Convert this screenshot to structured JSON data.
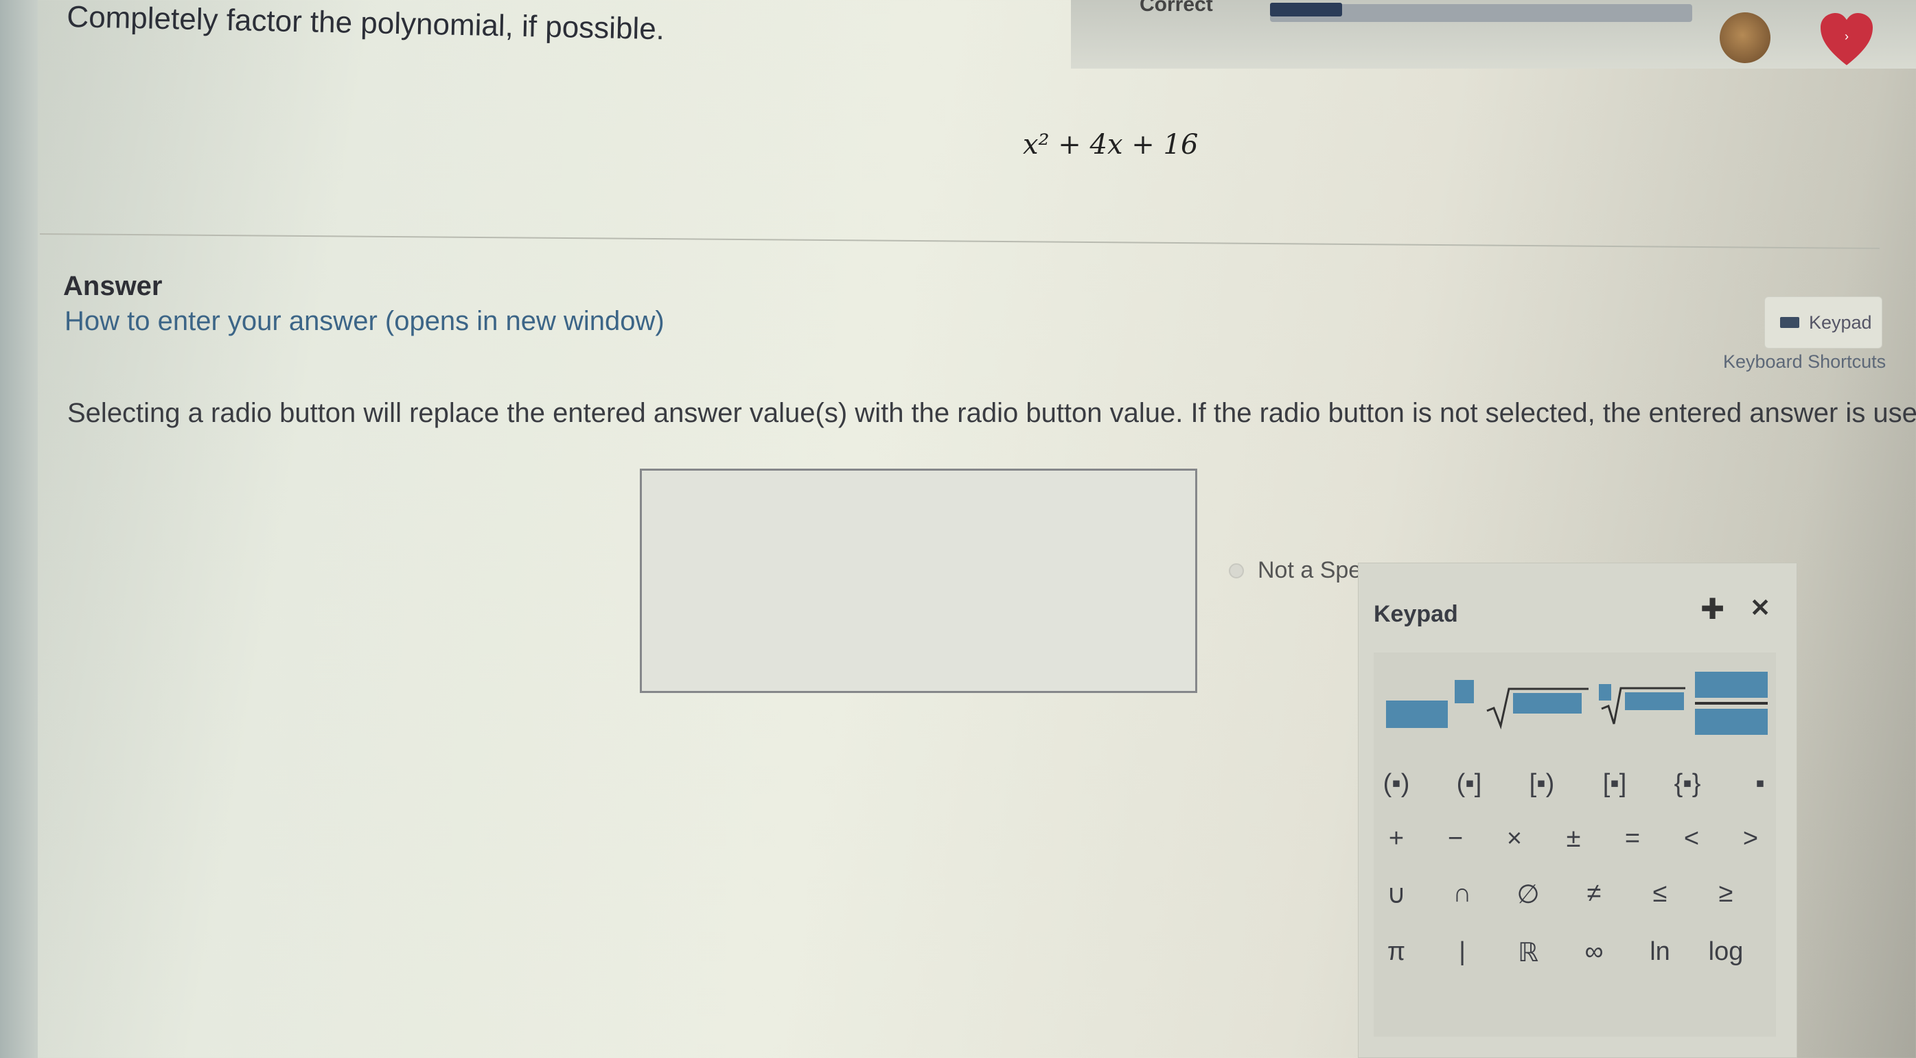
{
  "header": {
    "status": "Correct",
    "progress_fraction": 0.17
  },
  "question": {
    "prompt": "Completely factor the polynomial, if possible.",
    "expression": "x² + 4x + 16"
  },
  "answer": {
    "heading": "Answer",
    "help_link": "How to enter your answer (opens in new window)",
    "keypad_toggle": "Keypad",
    "shortcuts_link": "Keyboard Shortcuts",
    "instructions": "Selecting a radio button will replace the entered answer value(s) with the radio button value. If the radio button is not selected, the entered answer is used",
    "input_value": "",
    "radio_label": "Not a Spec"
  },
  "keypad": {
    "title": "Keypad",
    "move_icon": "move-icon",
    "close_icon": "close-icon",
    "rows": [
      [
        "(▪)",
        "(▪]",
        "[▪)",
        "[▪]",
        "{▪}",
        "▪"
      ],
      [
        "+",
        "−",
        "×",
        "±",
        "=",
        "<",
        ">"
      ],
      [
        "∪",
        "∩",
        "∅",
        "≠",
        "≤",
        "≥"
      ],
      [
        "π",
        "|",
        "ℝ",
        "∞",
        "ln",
        "log"
      ]
    ]
  },
  "colors": {
    "accent": "#4f89ad",
    "progress": "#2b3c58",
    "heart": "#c9303f"
  }
}
